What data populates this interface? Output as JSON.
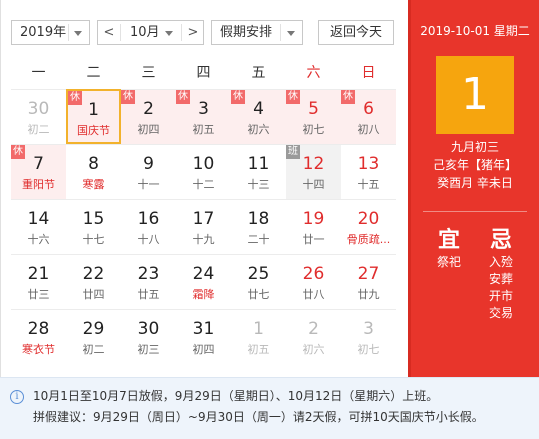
{
  "toolbar": {
    "year": "2019年",
    "month": "10月",
    "prev": "<",
    "next": ">",
    "holiday_select": "假期安排",
    "today_button": "返回今天"
  },
  "weekdays": [
    "一",
    "二",
    "三",
    "四",
    "五",
    "六",
    "日"
  ],
  "days": [
    {
      "n": "30",
      "s": "初二",
      "other": true
    },
    {
      "n": "1",
      "s": "国庆节",
      "fest": true,
      "tag": "休",
      "holiday": true,
      "selected": true
    },
    {
      "n": "2",
      "s": "初四",
      "tag": "休",
      "holiday": true
    },
    {
      "n": "3",
      "s": "初五",
      "tag": "休",
      "holiday": true
    },
    {
      "n": "4",
      "s": "初六",
      "tag": "休",
      "holiday": true
    },
    {
      "n": "5",
      "s": "初七",
      "tag": "休",
      "holiday": true
    },
    {
      "n": "6",
      "s": "初八",
      "tag": "休",
      "holiday": true
    },
    {
      "n": "7",
      "s": "重阳节",
      "fest": true,
      "tag": "休",
      "holiday": true
    },
    {
      "n": "8",
      "s": "寒露",
      "fest": true
    },
    {
      "n": "9",
      "s": "十一"
    },
    {
      "n": "10",
      "s": "十二"
    },
    {
      "n": "11",
      "s": "十三"
    },
    {
      "n": "12",
      "s": "十四",
      "tag": "班",
      "workday": true
    },
    {
      "n": "13",
      "s": "十五"
    },
    {
      "n": "14",
      "s": "十六"
    },
    {
      "n": "15",
      "s": "十七"
    },
    {
      "n": "16",
      "s": "十八"
    },
    {
      "n": "17",
      "s": "十九"
    },
    {
      "n": "18",
      "s": "二十"
    },
    {
      "n": "19",
      "s": "廿一"
    },
    {
      "n": "20",
      "s": "骨质疏...",
      "fest": true
    },
    {
      "n": "21",
      "s": "廿三"
    },
    {
      "n": "22",
      "s": "廿四"
    },
    {
      "n": "23",
      "s": "廿五"
    },
    {
      "n": "24",
      "s": "霜降",
      "fest": true
    },
    {
      "n": "25",
      "s": "廿七"
    },
    {
      "n": "26",
      "s": "廿八"
    },
    {
      "n": "27",
      "s": "廿九"
    },
    {
      "n": "28",
      "s": "寒衣节",
      "fest": true
    },
    {
      "n": "29",
      "s": "初二"
    },
    {
      "n": "30",
      "s": "初三"
    },
    {
      "n": "31",
      "s": "初四"
    },
    {
      "n": "1",
      "s": "初五",
      "other": true
    },
    {
      "n": "2",
      "s": "初六",
      "other": true
    },
    {
      "n": "3",
      "s": "初七",
      "other": true
    }
  ],
  "side": {
    "date_line": "2019-10-01 星期二",
    "big_day": "1",
    "lunar": [
      "九月初三",
      "己亥年【猪年】",
      "癸酉月 辛未日"
    ],
    "yi_title": "宜",
    "ji_title": "忌",
    "yi": [
      "祭祀"
    ],
    "ji": [
      "入殓",
      "安葬",
      "开市",
      "交易"
    ]
  },
  "notice": {
    "icon": "i",
    "line1": "10月1日至10月7日放假，9月29日（星期日）、10月12日（星期六）上班。",
    "line2": "拼假建议：9月29日（周日）~9月30日（周一）请2天假，可拼10天国庆节小长假。"
  },
  "colors": {
    "accent": "#e8352b",
    "highlight": "#f6a50e",
    "holiday_bg": "#fdeeee"
  }
}
